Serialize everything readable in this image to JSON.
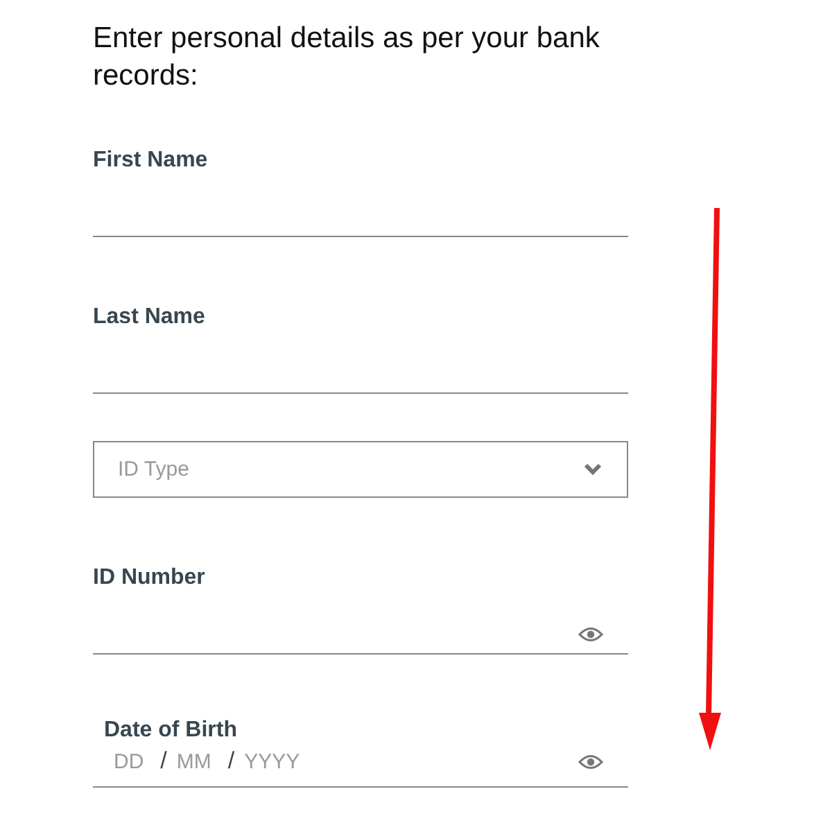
{
  "heading": "Enter personal details as per your bank records:",
  "fields": [
    {
      "kind": "text",
      "label": "First Name"
    },
    {
      "kind": "text",
      "label": "Last Name"
    },
    {
      "kind": "select",
      "placeholder": "ID Type"
    },
    {
      "kind": "secret",
      "label": "ID Number"
    },
    {
      "kind": "date",
      "label": "Date of Birth",
      "parts": [
        {
          "placeholder": "DD"
        },
        {
          "separator": "/"
        },
        {
          "placeholder": "MM"
        },
        {
          "separator": "/"
        },
        {
          "placeholder": "YYYY"
        }
      ]
    }
  ]
}
